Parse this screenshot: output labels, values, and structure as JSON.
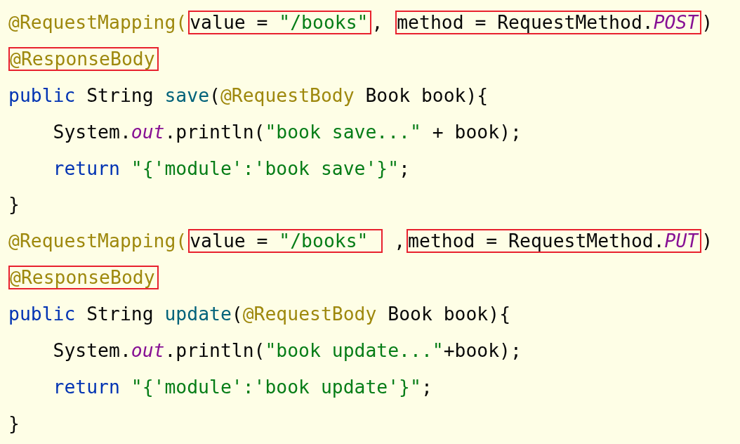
{
  "lines": [
    {
      "parts": [
        {
          "boxed": false,
          "tokens": [
            {
              "text": "@RequestMapping(",
              "kind": "annotation"
            }
          ]
        },
        {
          "boxed": true,
          "tokens": [
            {
              "text": "value = ",
              "kind": "plain"
            },
            {
              "text": "\"/books\"",
              "kind": "string"
            }
          ]
        },
        {
          "boxed": false,
          "tokens": [
            {
              "text": ", ",
              "kind": "plain"
            }
          ]
        },
        {
          "boxed": true,
          "tokens": [
            {
              "text": "method = RequestMethod.",
              "kind": "plain"
            },
            {
              "text": "POST",
              "kind": "field"
            }
          ]
        },
        {
          "boxed": false,
          "tokens": [
            {
              "text": ")",
              "kind": "plain"
            }
          ]
        }
      ]
    },
    {
      "parts": [
        {
          "boxed": true,
          "tokens": [
            {
              "text": "@ResponseBody",
              "kind": "annotation"
            }
          ]
        }
      ]
    },
    {
      "parts": [
        {
          "boxed": false,
          "tokens": [
            {
              "text": "public ",
              "kind": "keyword"
            },
            {
              "text": "String ",
              "kind": "plain"
            },
            {
              "text": "save",
              "kind": "method"
            },
            {
              "text": "(",
              "kind": "plain"
            },
            {
              "text": "@RequestBody ",
              "kind": "annotation"
            },
            {
              "text": "Book book){",
              "kind": "plain"
            }
          ]
        }
      ]
    },
    {
      "parts": [
        {
          "boxed": false,
          "tokens": [
            {
              "text": "    System.",
              "kind": "plain"
            },
            {
              "text": "out",
              "kind": "field"
            },
            {
              "text": ".println(",
              "kind": "plain"
            },
            {
              "text": "\"book save...\"",
              "kind": "string"
            },
            {
              "text": " + book);",
              "kind": "plain"
            }
          ]
        }
      ]
    },
    {
      "parts": [
        {
          "boxed": false,
          "tokens": [
            {
              "text": "    return ",
              "kind": "keyword"
            },
            {
              "text": "\"{'module':'book save'}\"",
              "kind": "string"
            },
            {
              "text": ";",
              "kind": "plain"
            }
          ]
        }
      ]
    },
    {
      "parts": [
        {
          "boxed": false,
          "tokens": [
            {
              "text": "}",
              "kind": "plain"
            }
          ]
        }
      ]
    },
    {
      "parts": [
        {
          "boxed": false,
          "tokens": [
            {
              "text": "@RequestMapping(",
              "kind": "annotation"
            }
          ]
        },
        {
          "boxed": true,
          "tokens": [
            {
              "text": "value = ",
              "kind": "plain"
            },
            {
              "text": "\"/books\" ",
              "kind": "string"
            }
          ]
        },
        {
          "boxed": false,
          "tokens": [
            {
              "text": " ,",
              "kind": "plain"
            }
          ]
        },
        {
          "boxed": true,
          "tokens": [
            {
              "text": "method = RequestMethod.",
              "kind": "plain"
            },
            {
              "text": "PUT",
              "kind": "field"
            }
          ]
        },
        {
          "boxed": false,
          "tokens": [
            {
              "text": ")",
              "kind": "plain"
            }
          ]
        }
      ]
    },
    {
      "parts": [
        {
          "boxed": true,
          "tokens": [
            {
              "text": "@ResponseBody",
              "kind": "annotation"
            }
          ]
        }
      ]
    },
    {
      "parts": [
        {
          "boxed": false,
          "tokens": [
            {
              "text": "public ",
              "kind": "keyword"
            },
            {
              "text": "String ",
              "kind": "plain"
            },
            {
              "text": "update",
              "kind": "method"
            },
            {
              "text": "(",
              "kind": "plain"
            },
            {
              "text": "@RequestBody ",
              "kind": "annotation"
            },
            {
              "text": "Book book){",
              "kind": "plain"
            }
          ]
        }
      ]
    },
    {
      "parts": [
        {
          "boxed": false,
          "tokens": [
            {
              "text": "    System.",
              "kind": "plain"
            },
            {
              "text": "out",
              "kind": "field"
            },
            {
              "text": ".println(",
              "kind": "plain"
            },
            {
              "text": "\"book update...\"",
              "kind": "string"
            },
            {
              "text": "+book);",
              "kind": "plain"
            }
          ]
        }
      ]
    },
    {
      "parts": [
        {
          "boxed": false,
          "tokens": [
            {
              "text": "    return ",
              "kind": "keyword"
            },
            {
              "text": "\"{'module':'book update'}\"",
              "kind": "string"
            },
            {
              "text": ";",
              "kind": "plain"
            }
          ]
        }
      ]
    },
    {
      "parts": [
        {
          "boxed": false,
          "tokens": [
            {
              "text": "}",
              "kind": "plain"
            }
          ]
        }
      ]
    }
  ]
}
